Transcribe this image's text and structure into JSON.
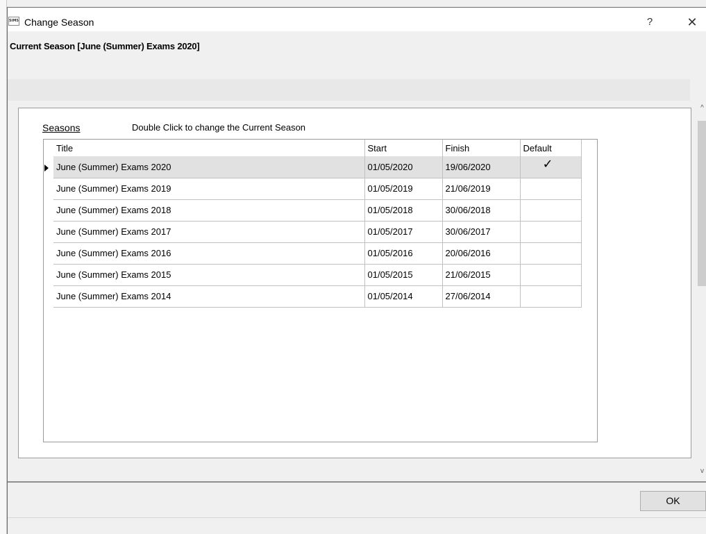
{
  "window": {
    "app_icon_text": "SIMS",
    "title": "Change Season",
    "help": "?",
    "close": "✕"
  },
  "header": {
    "current_season": "Current Season [June (Summer) Exams 2020]"
  },
  "seasons": {
    "label": "Seasons",
    "hint": "Double Click to change the Current Season",
    "columns": [
      "Title",
      "Start",
      "Finish",
      "Default"
    ],
    "rows": [
      {
        "title": "June (Summer) Exams 2020",
        "start": "01/05/2020",
        "finish": "19/06/2020",
        "default": "✓"
      },
      {
        "title": "June (Summer) Exams 2019",
        "start": "01/05/2019",
        "finish": "21/06/2019",
        "default": ""
      },
      {
        "title": "June (Summer) Exams 2018",
        "start": "01/05/2018",
        "finish": "30/06/2018",
        "default": ""
      },
      {
        "title": "June (Summer) Exams 2017",
        "start": "01/05/2017",
        "finish": "30/06/2017",
        "default": ""
      },
      {
        "title": "June (Summer) Exams 2016",
        "start": "01/05/2016",
        "finish": "20/06/2016",
        "default": ""
      },
      {
        "title": "June (Summer) Exams 2015",
        "start": "01/05/2015",
        "finish": "21/06/2015",
        "default": ""
      },
      {
        "title": "June (Summer) Exams 2014",
        "start": "01/05/2014",
        "finish": "27/06/2014",
        "default": ""
      }
    ]
  },
  "footer": {
    "ok_label": "OK"
  },
  "scroll": {
    "up": "^",
    "down": "v"
  }
}
